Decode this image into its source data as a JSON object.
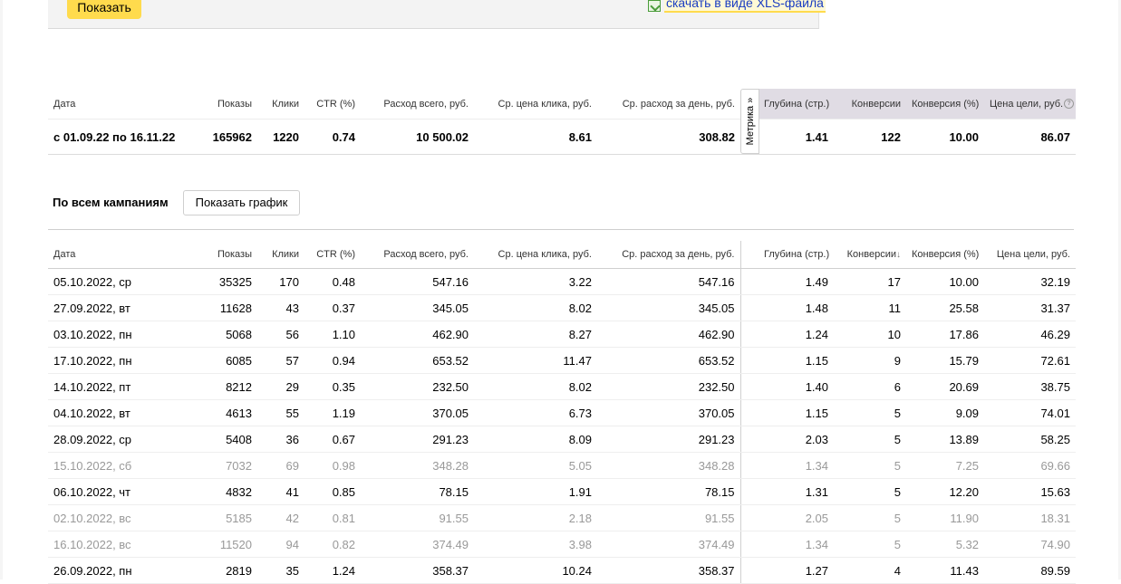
{
  "top": {
    "show_button": "Показать",
    "xls_link": "скачать в виде XLS-файла"
  },
  "metrika_tab": "Метрика »",
  "columns": {
    "date": "Дата",
    "shows": "Показы",
    "clicks": "Клики",
    "ctr": "CTR (%)",
    "spend": "Расход всего, руб.",
    "cpc": "Ср. цена клика, руб.",
    "daily": "Ср. расход за день, руб.",
    "depth": "Глубина (стр.)",
    "conv": "Конверсии",
    "convp": "Конверсия (%)",
    "goal": "Цена цели, руб."
  },
  "summary": {
    "date": "с 01.09.22 по 16.11.22",
    "shows": "165962",
    "clicks": "1220",
    "ctr": "0.74",
    "spend": "10 500.02",
    "cpc": "8.61",
    "daily": "308.82",
    "depth": "1.41",
    "conv": "122",
    "convp": "10.00",
    "goal": "86.07"
  },
  "campaigns": {
    "title": "По всем кампаниям",
    "graph_button": "Показать график",
    "sort_indicator": "↓"
  },
  "rows": [
    {
      "date": "05.10.2022, ср",
      "shows": "35325",
      "clicks": "170",
      "ctr": "0.48",
      "spend": "547.16",
      "cpc": "3.22",
      "daily": "547.16",
      "depth": "1.49",
      "conv": "17",
      "convp": "10.00",
      "goal": "32.19",
      "dim": false
    },
    {
      "date": "27.09.2022, вт",
      "shows": "11628",
      "clicks": "43",
      "ctr": "0.37",
      "spend": "345.05",
      "cpc": "8.02",
      "daily": "345.05",
      "depth": "1.48",
      "conv": "11",
      "convp": "25.58",
      "goal": "31.37",
      "dim": false
    },
    {
      "date": "03.10.2022, пн",
      "shows": "5068",
      "clicks": "56",
      "ctr": "1.10",
      "spend": "462.90",
      "cpc": "8.27",
      "daily": "462.90",
      "depth": "1.24",
      "conv": "10",
      "convp": "17.86",
      "goal": "46.29",
      "dim": false
    },
    {
      "date": "17.10.2022, пн",
      "shows": "6085",
      "clicks": "57",
      "ctr": "0.94",
      "spend": "653.52",
      "cpc": "11.47",
      "daily": "653.52",
      "depth": "1.15",
      "conv": "9",
      "convp": "15.79",
      "goal": "72.61",
      "dim": false
    },
    {
      "date": "14.10.2022, пт",
      "shows": "8212",
      "clicks": "29",
      "ctr": "0.35",
      "spend": "232.50",
      "cpc": "8.02",
      "daily": "232.50",
      "depth": "1.40",
      "conv": "6",
      "convp": "20.69",
      "goal": "38.75",
      "dim": false
    },
    {
      "date": "04.10.2022, вт",
      "shows": "4613",
      "clicks": "55",
      "ctr": "1.19",
      "spend": "370.05",
      "cpc": "6.73",
      "daily": "370.05",
      "depth": "1.15",
      "conv": "5",
      "convp": "9.09",
      "goal": "74.01",
      "dim": false
    },
    {
      "date": "28.09.2022, ср",
      "shows": "5408",
      "clicks": "36",
      "ctr": "0.67",
      "spend": "291.23",
      "cpc": "8.09",
      "daily": "291.23",
      "depth": "2.03",
      "conv": "5",
      "convp": "13.89",
      "goal": "58.25",
      "dim": false
    },
    {
      "date": "15.10.2022, сб",
      "shows": "7032",
      "clicks": "69",
      "ctr": "0.98",
      "spend": "348.28",
      "cpc": "5.05",
      "daily": "348.28",
      "depth": "1.34",
      "conv": "5",
      "convp": "7.25",
      "goal": "69.66",
      "dim": true
    },
    {
      "date": "06.10.2022, чт",
      "shows": "4832",
      "clicks": "41",
      "ctr": "0.85",
      "spend": "78.15",
      "cpc": "1.91",
      "daily": "78.15",
      "depth": "1.31",
      "conv": "5",
      "convp": "12.20",
      "goal": "15.63",
      "dim": false
    },
    {
      "date": "02.10.2022, вс",
      "shows": "5185",
      "clicks": "42",
      "ctr": "0.81",
      "spend": "91.55",
      "cpc": "2.18",
      "daily": "91.55",
      "depth": "2.05",
      "conv": "5",
      "convp": "11.90",
      "goal": "18.31",
      "dim": true
    },
    {
      "date": "16.10.2022, вс",
      "shows": "11520",
      "clicks": "94",
      "ctr": "0.82",
      "spend": "374.49",
      "cpc": "3.98",
      "daily": "374.49",
      "depth": "1.34",
      "conv": "5",
      "convp": "5.32",
      "goal": "74.90",
      "dim": true
    },
    {
      "date": "26.09.2022, пн",
      "shows": "2819",
      "clicks": "35",
      "ctr": "1.24",
      "spend": "358.37",
      "cpc": "10.24",
      "daily": "358.37",
      "depth": "1.27",
      "conv": "4",
      "convp": "11.43",
      "goal": "89.59",
      "dim": false
    }
  ]
}
